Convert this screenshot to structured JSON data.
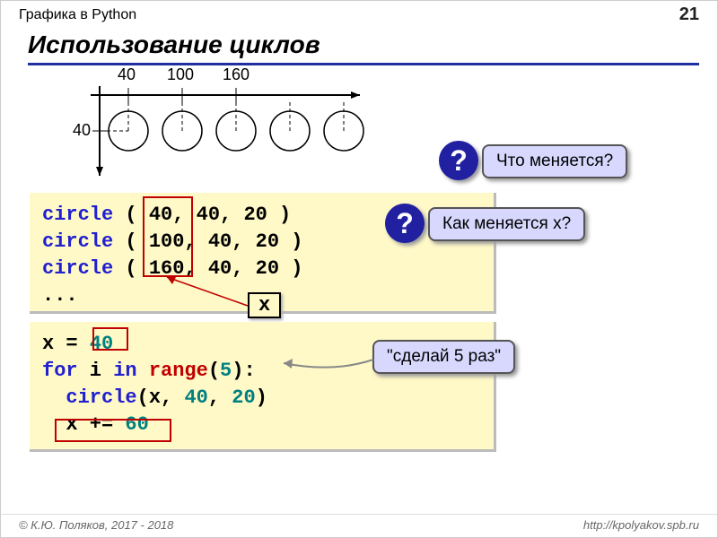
{
  "header": {
    "subject": "Графика в Python",
    "page": "21"
  },
  "title": "Использование циклов",
  "axis": {
    "ticks": [
      "40",
      "100",
      "160"
    ],
    "ylabel": "40"
  },
  "callouts": {
    "q1": "?",
    "what_changes": "Что меняется?",
    "q2": "?",
    "how_x_changes": "Как меняется x?",
    "do5": "\"сделай 5 раз\""
  },
  "code1": {
    "l1_fn": "circle",
    "l1_rest": " ( 40, 40, 20 )",
    "l2_fn": "circle",
    "l2_rest": " ( 100, 40, 20 )",
    "l3_fn": "circle",
    "l3_rest": " ( 160, 40, 20 )",
    "l4": "...",
    "xlabel": "x"
  },
  "code2": {
    "l1_pre": "x = ",
    "l1_val": "40",
    "l2_for": "for",
    "l2_i": " i ",
    "l2_in": "in",
    "l2_sp": " ",
    "l2_range": "range",
    "l2_args": "(",
    "l2_five": "5",
    "l2_close": "):",
    "l3_pre": "  ",
    "l3_fn": "circle",
    "l3_rest": "(x, ",
    "l3_a": "40",
    "l3_c": ", ",
    "l3_b": "20",
    "l3_end": ")",
    "l4_pre": "  x += ",
    "l4_val": "60"
  },
  "footer": {
    "copyright": "© К.Ю. Поляков, 2017 - 2018",
    "url": "http://kpolyakov.spb.ru"
  }
}
